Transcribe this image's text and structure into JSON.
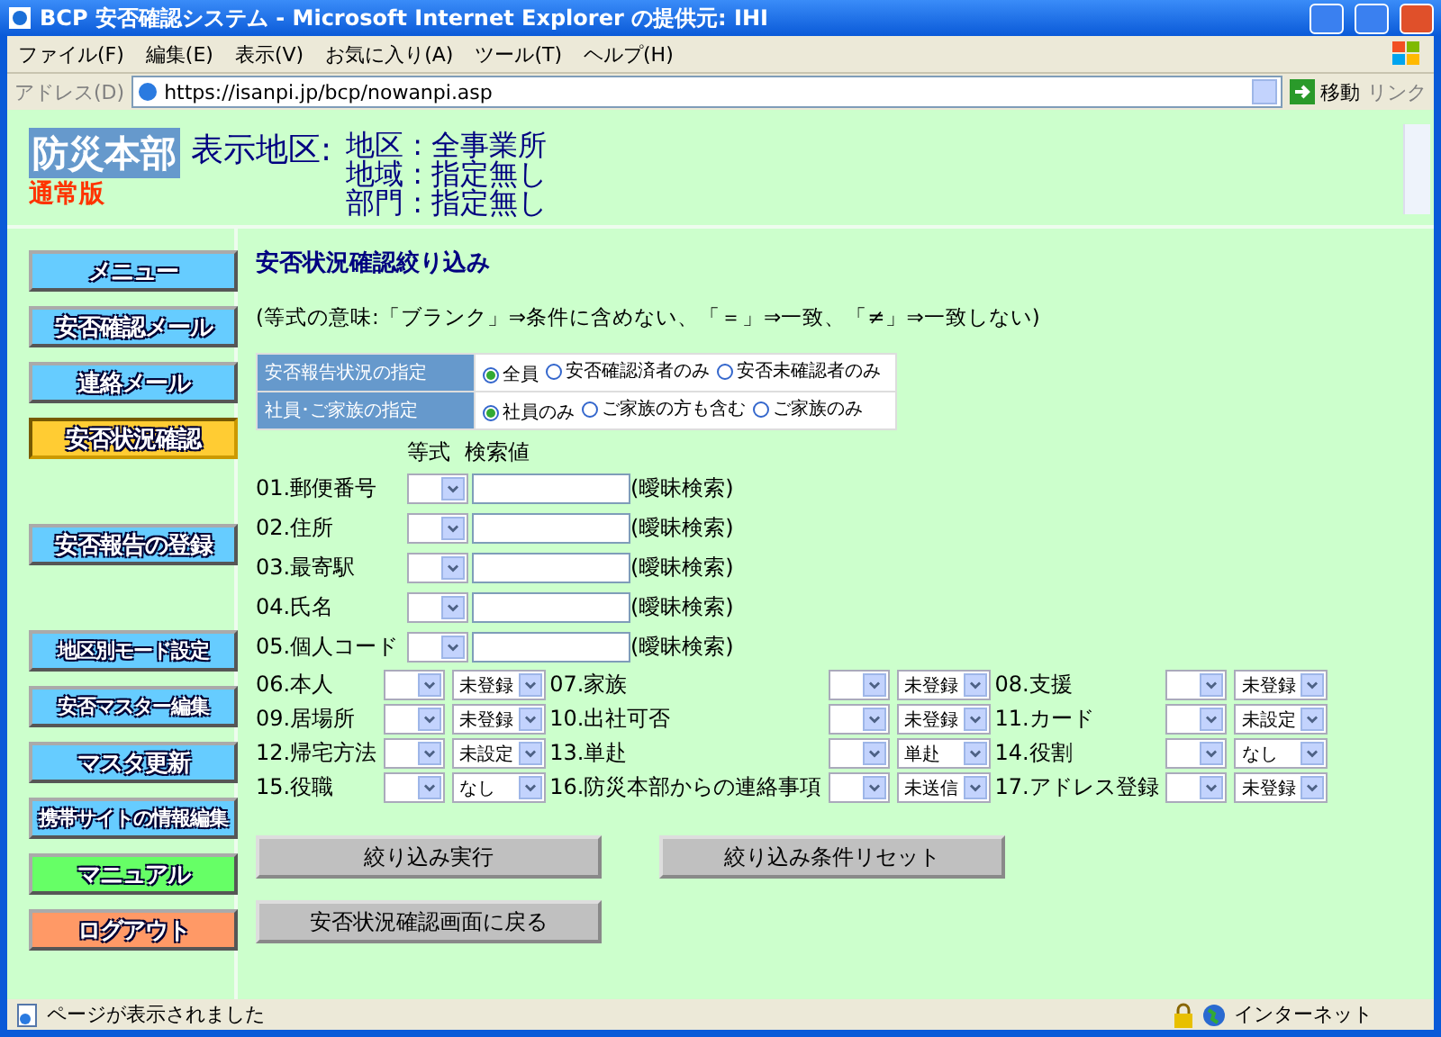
{
  "window": {
    "title": "BCP 安否確認システム - Microsoft Internet Explorer の提供元: IHI"
  },
  "menu": [
    "ファイル(F)",
    "編集(E)",
    "表示(V)",
    "お気に入り(A)",
    "ツール(T)",
    "ヘルプ(H)"
  ],
  "address_bar": {
    "label": "アドレス(D)",
    "url": "https://isanpi.jp/bcp/nowanpi.asp",
    "go": "移動",
    "links": "リンク"
  },
  "header": {
    "title": "防災本部",
    "edition": "通常版",
    "area_label": "表示地区:",
    "area_lines": [
      "地区 : 全事業所",
      "地域 : 指定無し",
      "部門 : 指定無し"
    ]
  },
  "sidebar": {
    "groups": [
      [
        {
          "label": "メニュー",
          "color": "#66ccff",
          "selected": false
        },
        {
          "label": "安否確認メール",
          "color": "#66ccff",
          "selected": false
        },
        {
          "label": "連絡メール",
          "color": "#66ccff",
          "selected": false
        },
        {
          "label": "安否状況確認",
          "color": "#ffcc33",
          "selected": true
        }
      ],
      [
        {
          "label": "安否報告の登録",
          "color": "#66ccff",
          "selected": false
        }
      ],
      [
        {
          "label": "地区別モード設定",
          "color": "#66ccff",
          "selected": false
        },
        {
          "label": "安否マスター編集",
          "color": "#66ccff",
          "selected": false
        },
        {
          "label": "マスタ更新",
          "color": "#66ccff",
          "selected": false
        },
        {
          "label": "携帯サイトの情報編集",
          "color": "#66ccff",
          "selected": false
        },
        {
          "label": "マニュアル",
          "color": "#66ff66",
          "selected": false
        },
        {
          "label": "ログアウト",
          "color": "#ff9966",
          "selected": false
        }
      ]
    ]
  },
  "main": {
    "heading": "安否状況確認絞り込み",
    "note": "(等式の意味:「ブランク」⇒条件に含めない、「＝」⇒一致、「≠」⇒一致しない)",
    "options": [
      {
        "label": "安否報告状況の指定",
        "choices": [
          {
            "label": "全員",
            "selected": true
          },
          {
            "label": "安否確認済者のみ",
            "selected": false
          },
          {
            "label": "安否未確認者のみ",
            "selected": false
          }
        ]
      },
      {
        "label": "社員･ご家族の指定",
        "choices": [
          {
            "label": "社員のみ",
            "selected": true
          },
          {
            "label": "ご家族の方も含む",
            "selected": false
          },
          {
            "label": "ご家族のみ",
            "selected": false
          }
        ]
      }
    ],
    "columns": [
      "等式",
      "検索値"
    ],
    "text_fields": [
      {
        "label": "01.郵便番号",
        "note": "(曖昧検索)"
      },
      {
        "label": "02.住所",
        "note": "(曖昧検索)"
      },
      {
        "label": "03.最寄駅",
        "note": "(曖昧検索)"
      },
      {
        "label": "04.氏名",
        "note": "(曖昧検索)"
      },
      {
        "label": "05.個人コード",
        "note": "(曖昧検索)"
      }
    ],
    "select_rows": [
      [
        {
          "label": "06.本人",
          "value": "未登録"
        },
        {
          "label": "07.家族",
          "value": "未登録"
        },
        {
          "label": "08.支援",
          "value": "未登録"
        }
      ],
      [
        {
          "label": "09.居場所",
          "value": "未登録"
        },
        {
          "label": "10.出社可否",
          "value": "未登録"
        },
        {
          "label": "11.カード",
          "value": "未設定"
        }
      ],
      [
        {
          "label": "12.帰宅方法",
          "value": "未設定"
        },
        {
          "label": "13.単赴",
          "value": "単赴"
        },
        {
          "label": "14.役割",
          "value": "なし"
        }
      ],
      [
        {
          "label": "15.役職",
          "value": "なし"
        },
        {
          "label": "16.防災本部からの連絡事項",
          "value": "未送信"
        },
        {
          "label": "17.アドレス登録",
          "value": "未登録"
        }
      ]
    ],
    "buttons": [
      [
        "絞り込み実行",
        "絞り込み条件リセット"
      ],
      [
        "安否状況確認画面に戻る"
      ]
    ]
  },
  "status_bar": {
    "text": "ページが表示されました",
    "zone": "インターネット"
  }
}
